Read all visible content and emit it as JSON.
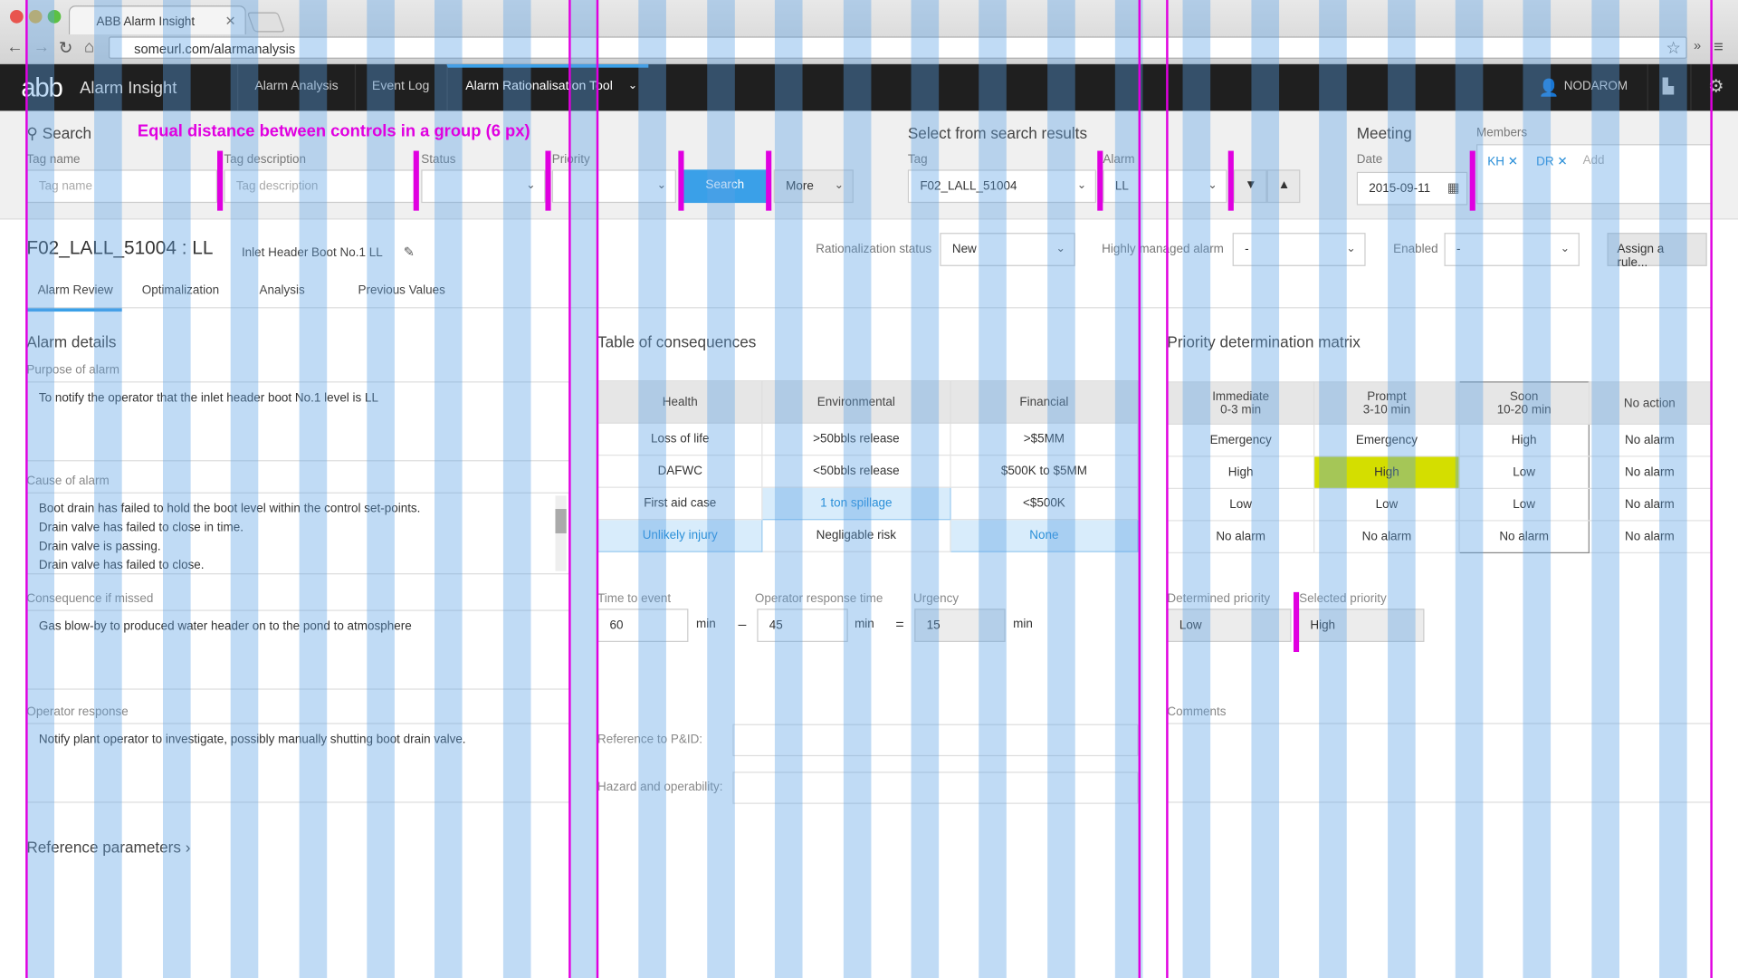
{
  "browser": {
    "tab_title": "ABB Alarm Insight",
    "url": "someurl.com/alarmanalysis"
  },
  "app": {
    "logo": "abb",
    "name": "Alarm Insight",
    "nav": [
      "Alarm Analysis",
      "Event Log",
      "Alarm Rationalisation Tool"
    ],
    "user": "NODAROM"
  },
  "search": {
    "title": "Search",
    "tag_name_label": "Tag name",
    "tag_name_placeholder": "Tag name",
    "tag_desc_label": "Tag description",
    "tag_desc_placeholder": "Tag description",
    "status_label": "Status",
    "priority_label": "Priority",
    "search_button": "Search",
    "more_button": "More"
  },
  "select_results": {
    "title": "Select from search results",
    "tag_label": "Tag",
    "tag_value": "F02_LALL_51004",
    "alarm_label": "Alarm",
    "alarm_value": "LL"
  },
  "meeting": {
    "title": "Meeting",
    "date_label": "Date",
    "date_value": "2015-09-11",
    "members_label": "Members",
    "members": [
      "KH",
      "DR"
    ],
    "add_label": "Add"
  },
  "alarm": {
    "id": "F02_LALL_51004 : LL",
    "description": "Inlet Header Boot No.1 LL",
    "rationalization_label": "Rationalization status",
    "rationalization_value": "New",
    "highly_managed_label": "Highly managed alarm",
    "highly_managed_value": "-",
    "enabled_label": "Enabled",
    "enabled_value": "-",
    "assign_button": "Assign a rule..."
  },
  "subtabs": [
    "Alarm Review",
    "Optimalization",
    "Analysis",
    "Previous Values"
  ],
  "details": {
    "title": "Alarm details",
    "purpose_label": "Purpose of alarm",
    "purpose": "To notify the operator that the inlet header boot No.1 level is LL",
    "cause_label": "Cause of alarm",
    "causes": [
      "Boot drain has failed to hold the boot level within the control set-points.",
      "Drain valve has failed to close in time.",
      "Drain valve is passing.",
      "Drain valve has failed to close."
    ],
    "consequence_label": "Consequence if missed",
    "consequence": "Gas blow-by to produced water header on to the pond to atmosphere",
    "response_label": "Operator response",
    "response": "Notify plant operator to investigate, possibly manually shutting boot drain valve.",
    "reference_params": "Reference parameters"
  },
  "consequences": {
    "title": "Table of consequences",
    "headers": [
      "Health",
      "Environmental",
      "Financial"
    ],
    "rows": [
      [
        "Loss of life",
        ">50bbls release",
        ">$5MM"
      ],
      [
        "DAFWC",
        "<50bbls release",
        "$500K to $5MM"
      ],
      [
        "First aid case",
        "1 ton spillage",
        "<$500K"
      ],
      [
        "Unlikely injury",
        "Negligable risk",
        "None"
      ]
    ],
    "time_label": "Time to event",
    "time_value": "60",
    "response_label": "Operator response time",
    "response_value": "45",
    "urgency_label": "Urgency",
    "urgency_value": "15",
    "unit": "min",
    "minus": "–",
    "equals": "=",
    "pid_label": "Reference to P&ID:",
    "hazard_label": "Hazard and operability:"
  },
  "priority": {
    "title": "Priority determination matrix",
    "headers": [
      {
        "name": "Immediate",
        "range": "0-3 min"
      },
      {
        "name": "Prompt",
        "range": "3-10 min"
      },
      {
        "name": "Soon",
        "range": "10-20 min"
      },
      {
        "name": "No action",
        "range": ""
      }
    ],
    "rows": [
      [
        "Emergency",
        "Emergency",
        "High",
        "No alarm"
      ],
      [
        "High",
        "High",
        "Low",
        "No alarm"
      ],
      [
        "Low",
        "Low",
        "Low",
        "No alarm"
      ],
      [
        "No alarm",
        "No alarm",
        "No alarm",
        "No alarm"
      ]
    ],
    "determined_label": "Determined priority",
    "determined_value": "Low",
    "selected_label": "Selected priority",
    "selected_value": "High",
    "comments_label": "Comments"
  },
  "annotation": "Equal distance between controls in a group (6 px)",
  "colors": {
    "accent": "#3aa0e8",
    "highlight": "#d4de00",
    "guide": "#e000e0",
    "header_bg": "#1f1f1f"
  }
}
